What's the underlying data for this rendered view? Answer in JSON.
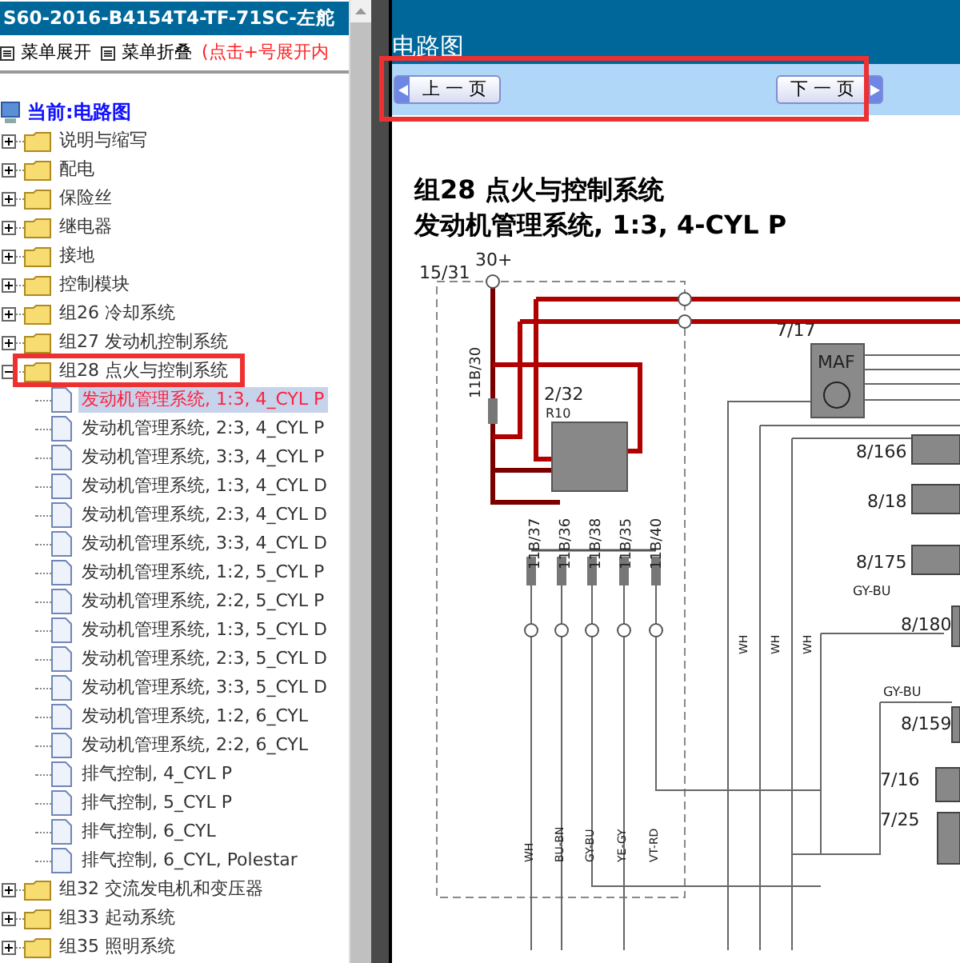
{
  "sidebar": {
    "title": "S60-2016-B4154T4-TF-71SC-左舵",
    "menu": [
      {
        "label": "菜单展开",
        "kind": "button"
      },
      {
        "label": "菜单折叠",
        "kind": "button"
      },
      {
        "label": "(点击+号展开内",
        "kind": "hint"
      }
    ],
    "current": "当前:电路图",
    "items": [
      {
        "label": "说明与缩写",
        "expanded": false
      },
      {
        "label": "配电",
        "expanded": false
      },
      {
        "label": "保险丝",
        "expanded": false
      },
      {
        "label": "继电器",
        "expanded": false
      },
      {
        "label": "接地",
        "expanded": false
      },
      {
        "label": "控制模块",
        "expanded": false
      },
      {
        "label": "组26 冷却系统",
        "expanded": false
      },
      {
        "label": "组27 发动机控制系统",
        "expanded": false
      },
      {
        "label": "组28 点火与控制系统",
        "expanded": true,
        "children": [
          {
            "label": "发动机管理系统, 1:3, 4_CYL P",
            "selected": true
          },
          {
            "label": "发动机管理系统, 2:3, 4_CYL P",
            "selected": false
          },
          {
            "label": "发动机管理系统, 3:3, 4_CYL P",
            "selected": false
          },
          {
            "label": "发动机管理系统, 1:3, 4_CYL D",
            "selected": false
          },
          {
            "label": "发动机管理系统, 2:3, 4_CYL D",
            "selected": false
          },
          {
            "label": "发动机管理系统, 3:3, 4_CYL D",
            "selected": false
          },
          {
            "label": "发动机管理系统, 1:2, 5_CYL P",
            "selected": false
          },
          {
            "label": "发动机管理系统, 2:2, 5_CYL P",
            "selected": false
          },
          {
            "label": "发动机管理系统, 1:3, 5_CYL D",
            "selected": false
          },
          {
            "label": "发动机管理系统, 2:3, 5_CYL D",
            "selected": false
          },
          {
            "label": "发动机管理系统, 3:3, 5_CYL D",
            "selected": false
          },
          {
            "label": "发动机管理系统, 1:2, 6_CYL",
            "selected": false
          },
          {
            "label": "发动机管理系统, 2:2, 6_CYL",
            "selected": false
          },
          {
            "label": "排气控制, 4_CYL P",
            "selected": false
          },
          {
            "label": "排气控制, 5_CYL P",
            "selected": false
          },
          {
            "label": "排气控制, 6_CYL",
            "selected": false
          },
          {
            "label": "排气控制, 6_CYL, Polestar",
            "selected": false
          }
        ]
      },
      {
        "label": "组32 交流发电机和变压器",
        "expanded": false
      },
      {
        "label": "组33 起动系统",
        "expanded": false
      },
      {
        "label": "组35 照明系统",
        "expanded": false
      }
    ]
  },
  "main": {
    "title": "电路图",
    "prev": "上 一 页",
    "next": "下 一 页",
    "heading": [
      "组28 点火与控制系统",
      "发动机管理系统, 1:3, 4-CYL P"
    ],
    "diagram_labels": [
      {
        "text": "30+",
        "kind": "label"
      },
      {
        "text": "15/31",
        "kind": "label"
      },
      {
        "text": "7/17",
        "kind": "label"
      },
      {
        "text": "11B/30",
        "kind": "vlabel"
      },
      {
        "text": "2/32",
        "kind": "label"
      },
      {
        "text": "R10",
        "kind": "small"
      },
      {
        "text": "MAF",
        "kind": "label"
      },
      {
        "text": "8/166",
        "kind": "label"
      },
      {
        "text": "8/18",
        "kind": "label"
      },
      {
        "text": "8/175",
        "kind": "label"
      },
      {
        "text": "GY-BU",
        "kind": "small"
      },
      {
        "text": "8/180",
        "kind": "label"
      },
      {
        "text": "WH",
        "kind": "vsmall"
      },
      {
        "text": "WH",
        "kind": "vsmall"
      },
      {
        "text": "WH",
        "kind": "vsmall"
      },
      {
        "text": "GY-BU",
        "kind": "small"
      },
      {
        "text": "8/159",
        "kind": "label"
      },
      {
        "text": "7/16",
        "kind": "label"
      },
      {
        "text": "7/25",
        "kind": "label"
      },
      {
        "text": "11B/37",
        "kind": "vlabel"
      },
      {
        "text": "11B/36",
        "kind": "vlabel"
      },
      {
        "text": "11B/38",
        "kind": "vlabel"
      },
      {
        "text": "11B/35",
        "kind": "vlabel"
      },
      {
        "text": "11B/40",
        "kind": "vlabel"
      },
      {
        "text": "WH",
        "kind": "vsmall"
      },
      {
        "text": "BU-BN",
        "kind": "vsmall"
      },
      {
        "text": "GY-BU",
        "kind": "vsmall"
      },
      {
        "text": "YE-GY",
        "kind": "vsmall"
      },
      {
        "text": "VT-RD",
        "kind": "vsmall"
      }
    ]
  }
}
